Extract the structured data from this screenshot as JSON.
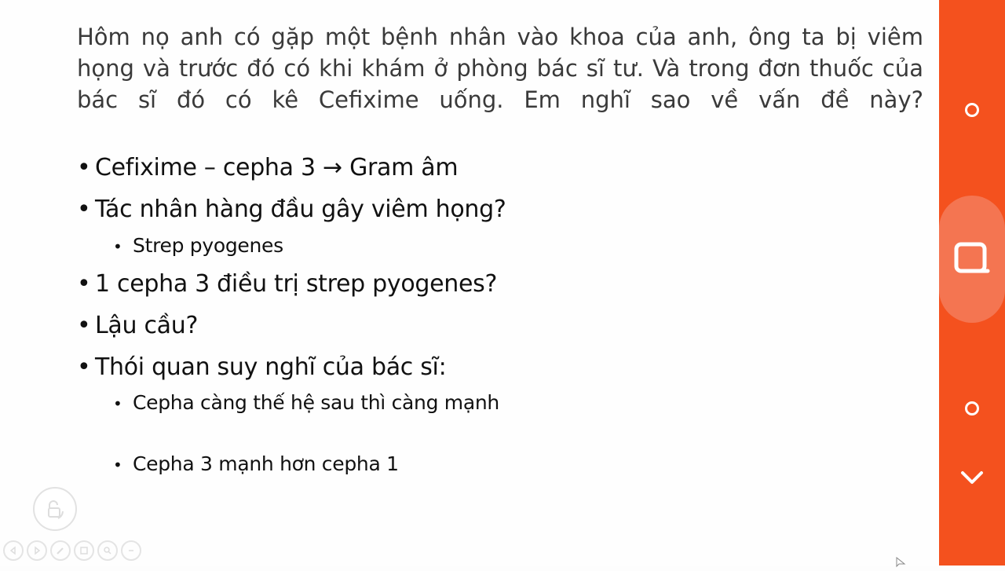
{
  "slide": {
    "question_lines": [
      "Hôm nọ anh có gặp một bệnh nhân vào khoa của anh, ông ta bị viêm",
      "họng và trước đó có khi khám ở phòng bác sĩ tư. Và trong đơn thuốc của",
      "bác sĩ đó có kê Cefixime uống. Em nghĩ sao về vấn đề này?"
    ],
    "bullets": [
      {
        "level": 1,
        "text": "Cefixime – cepha 3 → Gram âm"
      },
      {
        "level": 1,
        "text": "Tác nhân hàng đầu gây viêm họng?"
      },
      {
        "level": 2,
        "text": "Strep pyogenes"
      },
      {
        "level": 1,
        "text": "1 cepha 3 điều trị strep pyogenes?"
      },
      {
        "level": 1,
        "text": "Lậu cầu?"
      },
      {
        "level": 1,
        "text": "Thói quan suy nghĩ của bác sĩ:"
      },
      {
        "level": 2,
        "text": "Cepha càng thế hệ sau thì càng mạnh"
      },
      {
        "level": 2,
        "text": "Cepha 3 mạnh hơn cepha 1"
      }
    ],
    "bullet_char": "•"
  },
  "icons": {
    "lock": "unlock-rotate-icon",
    "toolbar": [
      "previous-slide-icon",
      "next-slide-icon",
      "pen-icon",
      "slides-grid-icon",
      "zoom-icon",
      "more-options-icon"
    ],
    "sidebar": [
      "small-circle-icon",
      "screen-record-icon",
      "small-circle-icon",
      "chevron-down-icon"
    ]
  },
  "colors": {
    "sidebar_bg": "#f4511e",
    "sidebar_button_bg": "#f47551"
  }
}
